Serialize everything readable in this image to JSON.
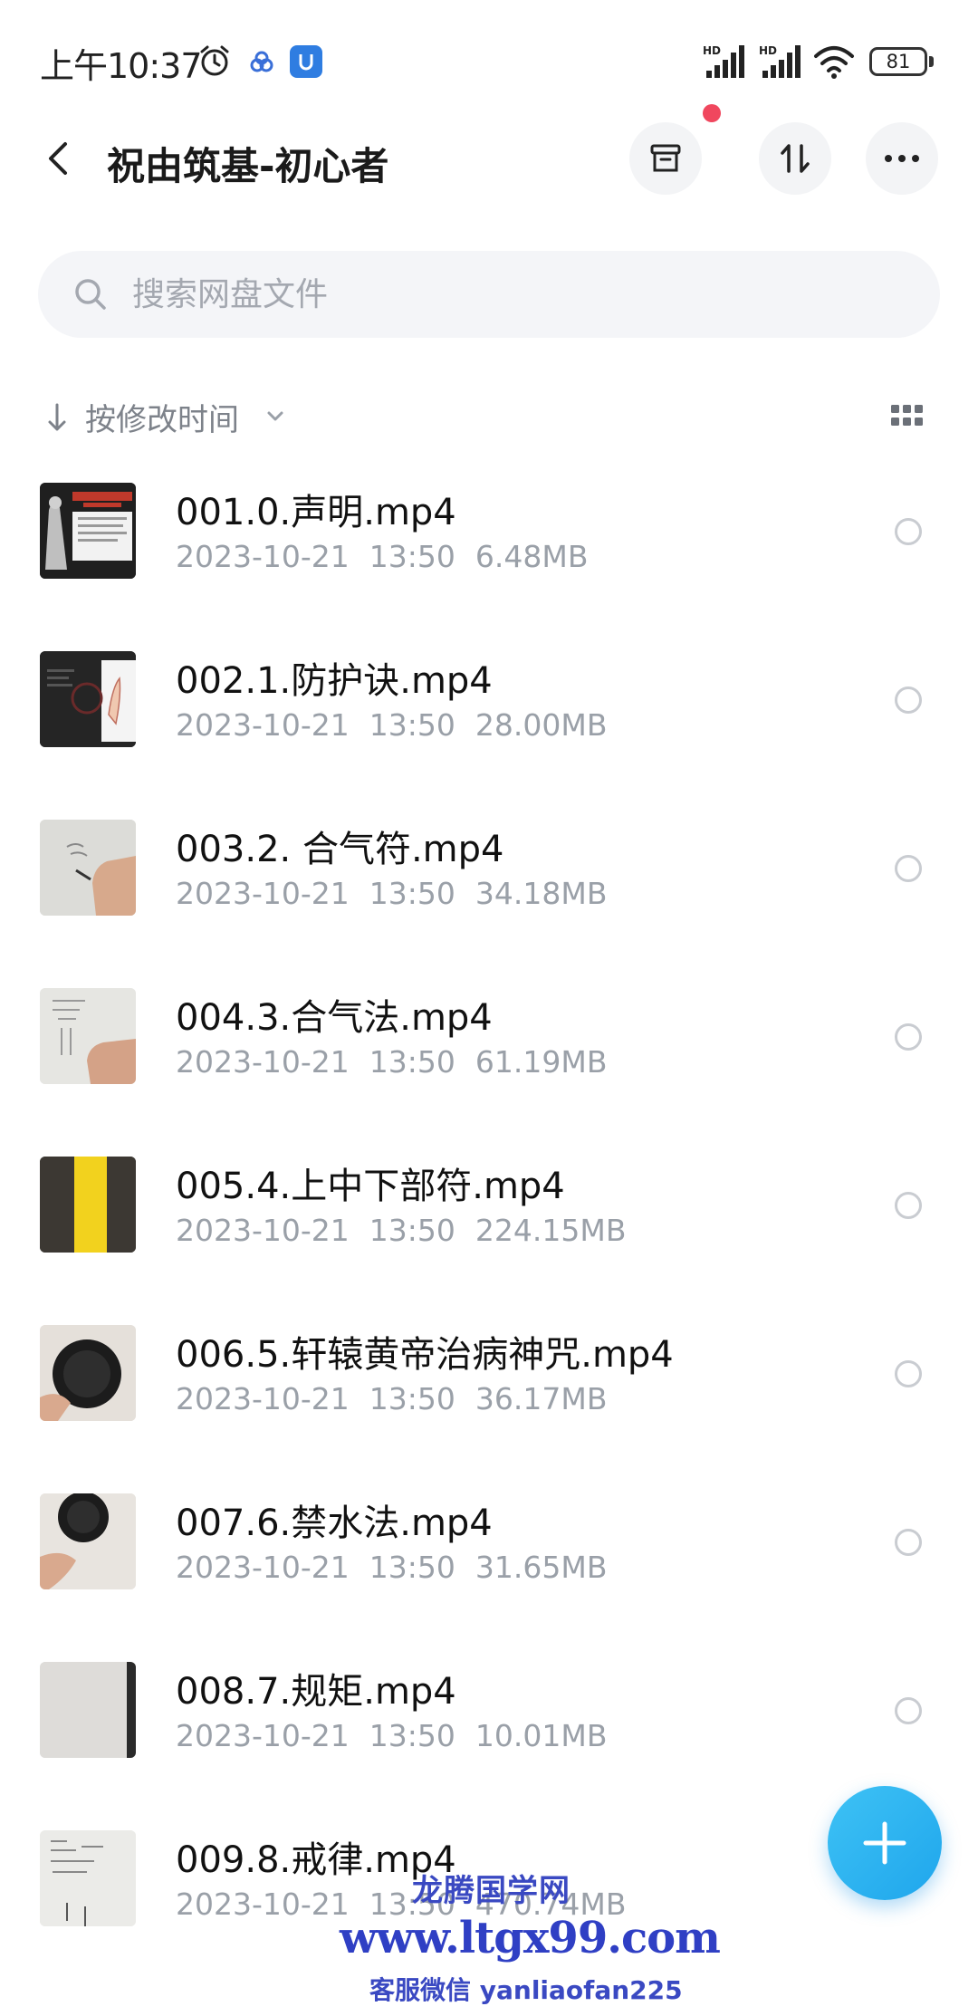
{
  "status_bar": {
    "time": "上午10:37",
    "battery": "81",
    "signal_1_label": "HD",
    "signal_2_label": "HD"
  },
  "header": {
    "title": "祝由筑基-初心者"
  },
  "search": {
    "placeholder": "搜索网盘文件"
  },
  "sort": {
    "label": "按修改时间"
  },
  "files": [
    {
      "name": "001.0.声明.mp4",
      "date": "2023-10-21",
      "time": "13:50",
      "size": "6.48MB"
    },
    {
      "name": "002.1.防护诀.mp4",
      "date": "2023-10-21",
      "time": "13:50",
      "size": "28.00MB"
    },
    {
      "name": "003.2. 合气符.mp4",
      "date": "2023-10-21",
      "time": "13:50",
      "size": "34.18MB"
    },
    {
      "name": "004.3.合气法.mp4",
      "date": "2023-10-21",
      "time": "13:50",
      "size": "61.19MB"
    },
    {
      "name": "005.4.上中下部符.mp4",
      "date": "2023-10-21",
      "time": "13:50",
      "size": "224.15MB"
    },
    {
      "name": "006.5.轩辕黄帝治病神咒.mp4",
      "date": "2023-10-21",
      "time": "13:50",
      "size": "36.17MB"
    },
    {
      "name": "007.6.禁水法.mp4",
      "date": "2023-10-21",
      "time": "13:50",
      "size": "31.65MB"
    },
    {
      "name": "008.7.规矩.mp4",
      "date": "2023-10-21",
      "time": "13:50",
      "size": "10.01MB"
    },
    {
      "name": "009.8.戒律.mp4",
      "date": "2023-10-21",
      "time": "13:50",
      "size": "470.74MB"
    }
  ],
  "watermark": {
    "name": "龙腾国学网",
    "url": "www.ltgx99.com",
    "wechat": "客服微信 yanliaofan225"
  },
  "colors": {
    "accent": "#1fa6ec",
    "notify": "#f0475e",
    "watermark": "#2f3fc4"
  }
}
